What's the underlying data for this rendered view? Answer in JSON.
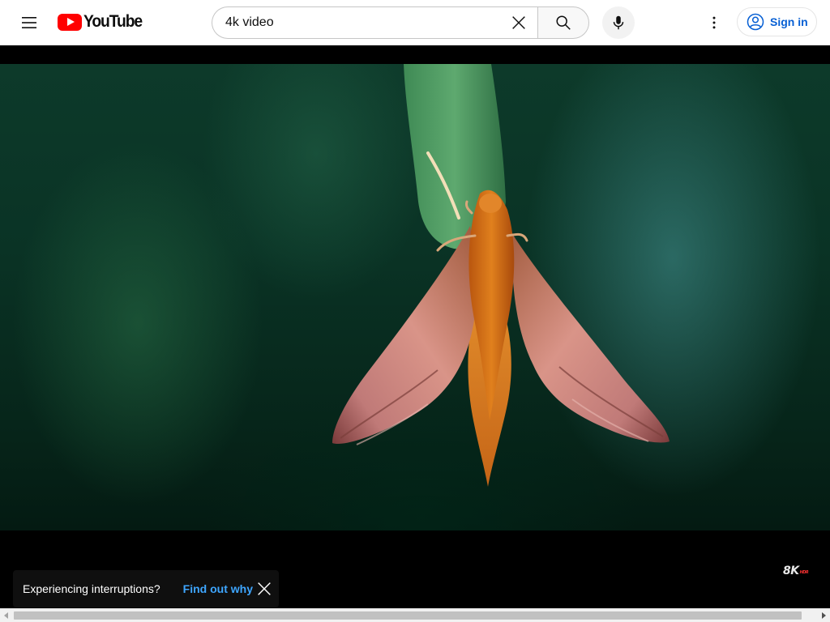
{
  "masthead": {
    "logo_text": "YouTube",
    "search": {
      "value": "4k video",
      "placeholder": "Search"
    },
    "signin_label": "Sign in"
  },
  "player": {
    "watermark_text": "8K",
    "watermark_badge": "HDR"
  },
  "toast": {
    "message": "Experiencing interruptions?",
    "link_label": "Find out why"
  },
  "colors": {
    "brand_red": "#ff0000",
    "link_blue": "#065fd4",
    "toast_link_blue": "#3ea6ff"
  },
  "icons": {
    "menu": "menu-icon",
    "search": "search-icon",
    "clear": "close-icon",
    "mic": "microphone-icon",
    "more": "more-vertical-icon",
    "account": "account-circle-icon",
    "toast_close": "close-icon",
    "scroll_left": "arrow-left-icon",
    "scroll_right": "arrow-right-icon"
  }
}
